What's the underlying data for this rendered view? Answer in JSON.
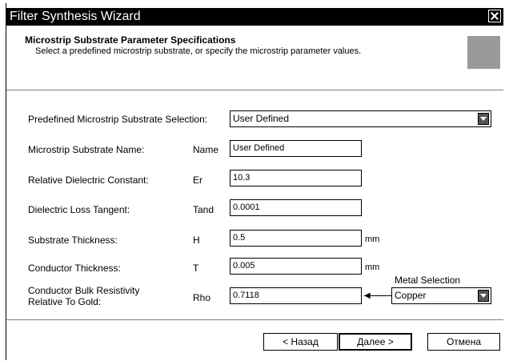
{
  "window": {
    "title": "Filter Synthesis Wizard"
  },
  "header": {
    "title": "Microstrip Substrate Parameter Specifications",
    "description": "Select a predefined microstrip substrate, or specify the microstrip parameter values."
  },
  "form": {
    "predefined": {
      "label": "Predefined Microstrip Substrate Selection:",
      "value": "User Defined"
    },
    "substrate_name": {
      "label": "Microstrip Substrate Name:",
      "symbol": "Name",
      "value": "User Defined"
    },
    "dielectric_constant": {
      "label": "Relative Dielectric Constant:",
      "symbol": "Er",
      "value": "10.3"
    },
    "loss_tangent": {
      "label": "Dielectric Loss Tangent:",
      "symbol": "Tand",
      "value": "0.0001"
    },
    "substrate_thickness": {
      "label": "Substrate Thickness:",
      "symbol": "H",
      "value": "0.5",
      "unit": "mm"
    },
    "conductor_thickness": {
      "label": "Conductor Thickness:",
      "symbol": "T",
      "value": "0.005",
      "unit": "mm"
    },
    "resistivity": {
      "label_line1": "Conductor Bulk Resistivity",
      "label_line2": "Relative To Gold:",
      "symbol": "Rho",
      "value": "0.7118"
    },
    "metal": {
      "label": "Metal Selection",
      "value": "Copper"
    }
  },
  "footer": {
    "back_label": "< Назад",
    "next_label": "Далее >",
    "cancel_label": "Отмена"
  },
  "colors": {
    "titlebar": "#000000",
    "header_graphic": "#9a9a9a"
  }
}
